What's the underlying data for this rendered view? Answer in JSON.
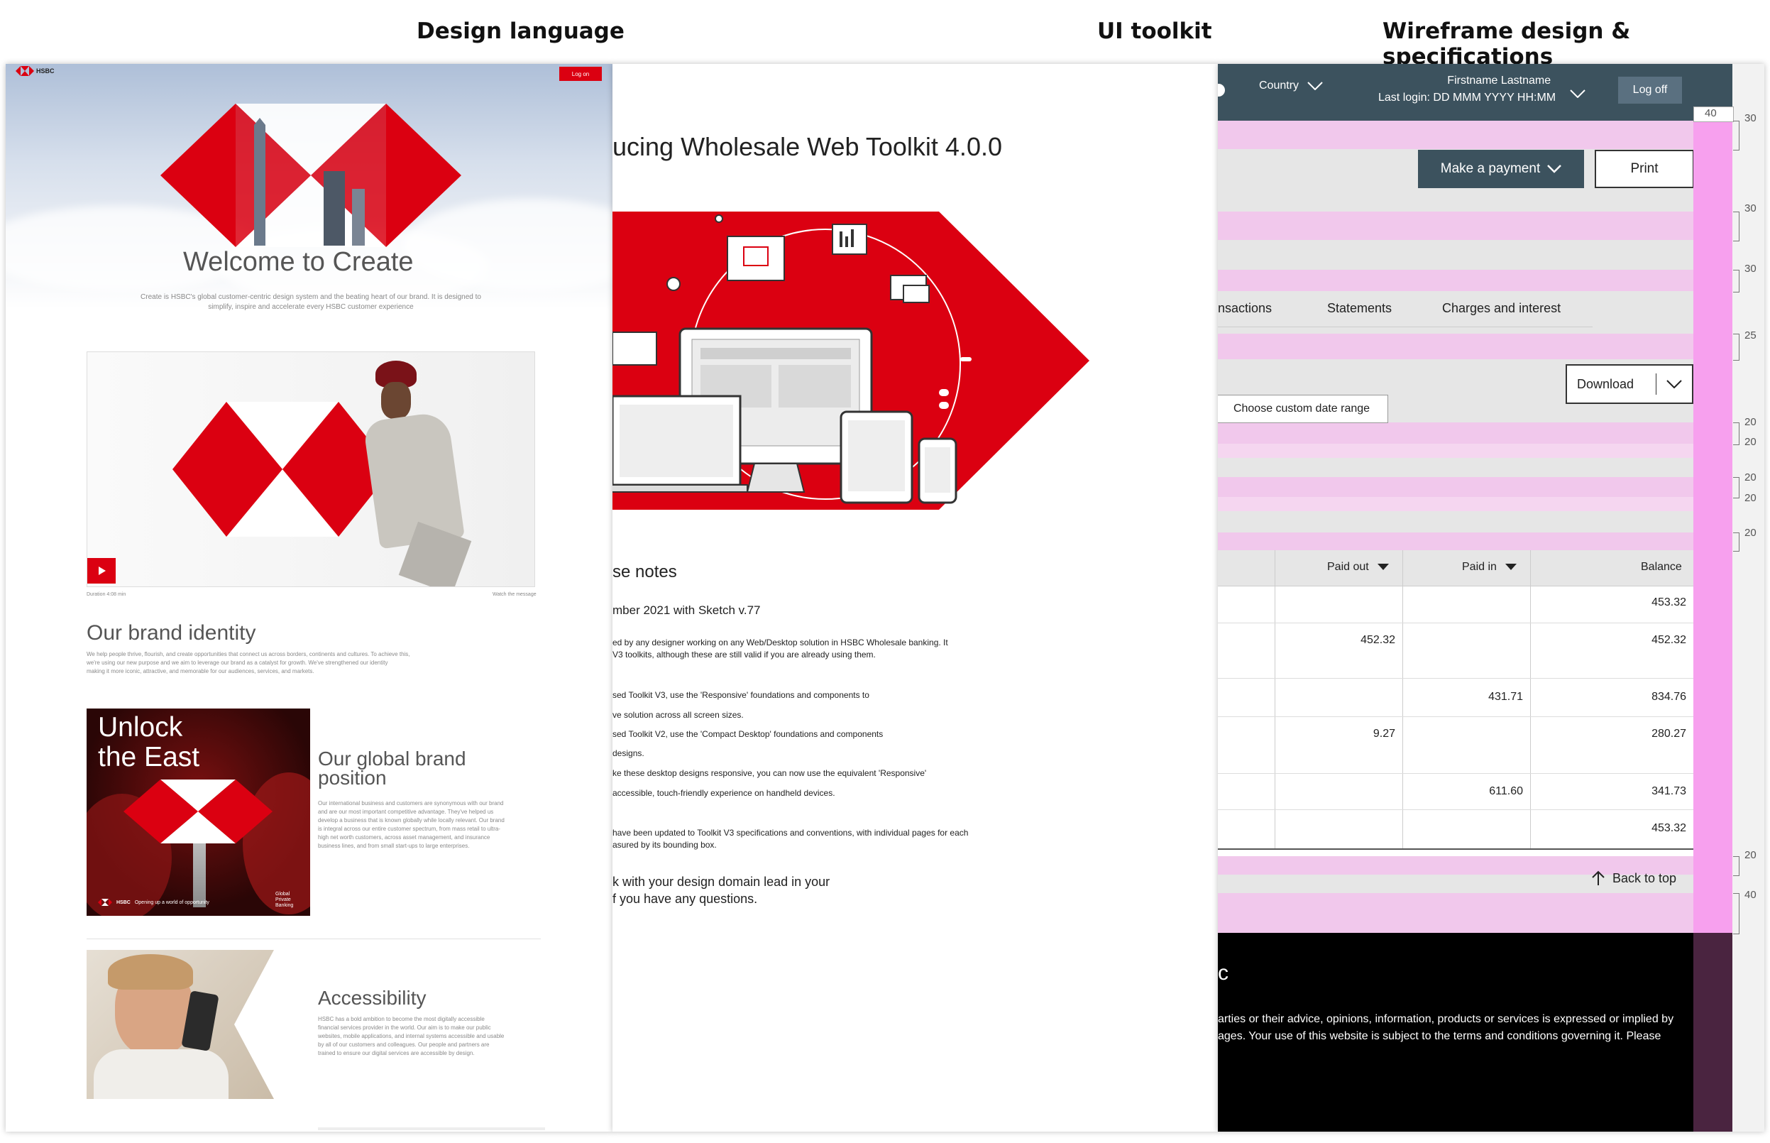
{
  "columns": {
    "design": "Design language",
    "toolkit": "UI toolkit",
    "wireframe": "Wireframe design & specifications"
  },
  "design_language": {
    "brand": "HSBC",
    "login": "Log on",
    "hero_title": "Welcome to Create",
    "hero_text_1": "Create is HSBC's global customer-centric design system and the beating heart of our brand. It is designed to",
    "hero_text_2": "simplify, inspire and accelerate every HSBC customer experience",
    "video_left": "Duration 4:08 min",
    "video_right": "Watch the message",
    "brand_identity_title": "Our brand identity",
    "brand_identity_text_1": "We help people thrive, flourish, and create opportunities that connect us across borders, continents and cultures. To achieve this,",
    "brand_identity_text_2": "we're using our new purpose and we aim to leverage our brand as a catalyst for growth. We've strengthened our identity",
    "brand_identity_text_3": "making it more iconic, attractive, and memorable for our audiences, services, and markets.",
    "poster_line_1": "Unlock",
    "poster_line_2": "the East",
    "poster_footer": "Opening up a world of opportunity",
    "poster_badge": "Global Private Banking",
    "global_title_1": "Our global brand",
    "global_title_2": "position",
    "global_text": [
      "Our international business and customers are synonymous with our brand",
      "and are our most important competitive advantage. They've helped us",
      "develop a business that is known globally while locally relevant. Our brand",
      "is integral across our entire customer spectrum, from mass retail to ultra-",
      "high net worth customers, across asset management, and insurance",
      "business lines, and from small start-ups to large enterprises."
    ],
    "accessibility_title": "Accessibility",
    "accessibility_text": [
      "HSBC has a bold ambition to become the most digitally accessible",
      "financial services provider in the world. Our aim is to make our public",
      "websites, mobile applications, and internal systems accessible and usable",
      "by all of our customers and colleagues. Our people and partners are",
      "trained to ensure our digital services are accessible by design."
    ]
  },
  "toolkit": {
    "title": "ucing Wholesale Web Toolkit 4.0.0",
    "release_heading": "se notes",
    "release_date": "mber 2021 with Sketch v.77",
    "lines": [
      "ed by any designer working on any Web/Desktop solution in HSBC Wholesale banking. It",
      "V3 toolkits, although these are still valid if you are already using them.",
      "sed Toolkit V3, use the 'Responsive' foundations and components to",
      "ve solution across all screen sizes.",
      "sed Toolkit V2, use the 'Compact Desktop' foundations and components",
      " designs.",
      "ke these desktop designs responsive, you can now use the equivalent 'Responsive'",
      " accessible, touch-friendly experience on handheld devices.",
      "have been updated to Toolkit V3 specifications and conventions, with individual pages for each",
      "asured by its bounding box."
    ],
    "contact_1": "k with your design domain lead in your",
    "contact_2": "f you have any questions."
  },
  "wireframe": {
    "country": "Country",
    "user_name": "Firstname Lastname",
    "last_login": "Last login: DD MMM YYYY HH:MM",
    "log_off": "Log off",
    "make_payment": "Make a payment",
    "print": "Print",
    "tabs": [
      "nsactions",
      "Statements",
      "Charges and interest"
    ],
    "download": "Download",
    "custom_range": "Choose custom date range",
    "col_paid_out": "Paid out",
    "col_paid_in": "Paid in",
    "col_balance": "Balance",
    "rows": [
      {
        "paid_out": "",
        "paid_in": "",
        "balance": "453.32"
      },
      {
        "paid_out": "452.32",
        "paid_in": "",
        "balance": "452.32"
      },
      {
        "paid_out": "",
        "paid_in": "431.71",
        "balance": "834.76"
      },
      {
        "paid_out": "9.27",
        "paid_in": "",
        "balance": "280.27"
      },
      {
        "paid_out": "",
        "paid_in": "611.60",
        "balance": "341.73"
      },
      {
        "paid_out": "",
        "paid_in": "",
        "balance": "453.32"
      }
    ],
    "back_to_top": "Back to top",
    "footer_letter": "c",
    "footer_line_1": "arties or their advice, opinions, information, products or services is expressed or implied by",
    "footer_line_2": "ages. Your use of this website is subject to the terms and conditions governing it. Please",
    "ruler": [
      "40",
      "30",
      "30",
      "30",
      "25",
      "20",
      "20",
      "20",
      "20",
      "20",
      "20",
      "40"
    ],
    "colors": {
      "header": "#3c525e",
      "pink": "#f1c8ec",
      "magenta": "#f7a0ee",
      "footer": "#000000",
      "brand_red": "#db0011"
    }
  }
}
